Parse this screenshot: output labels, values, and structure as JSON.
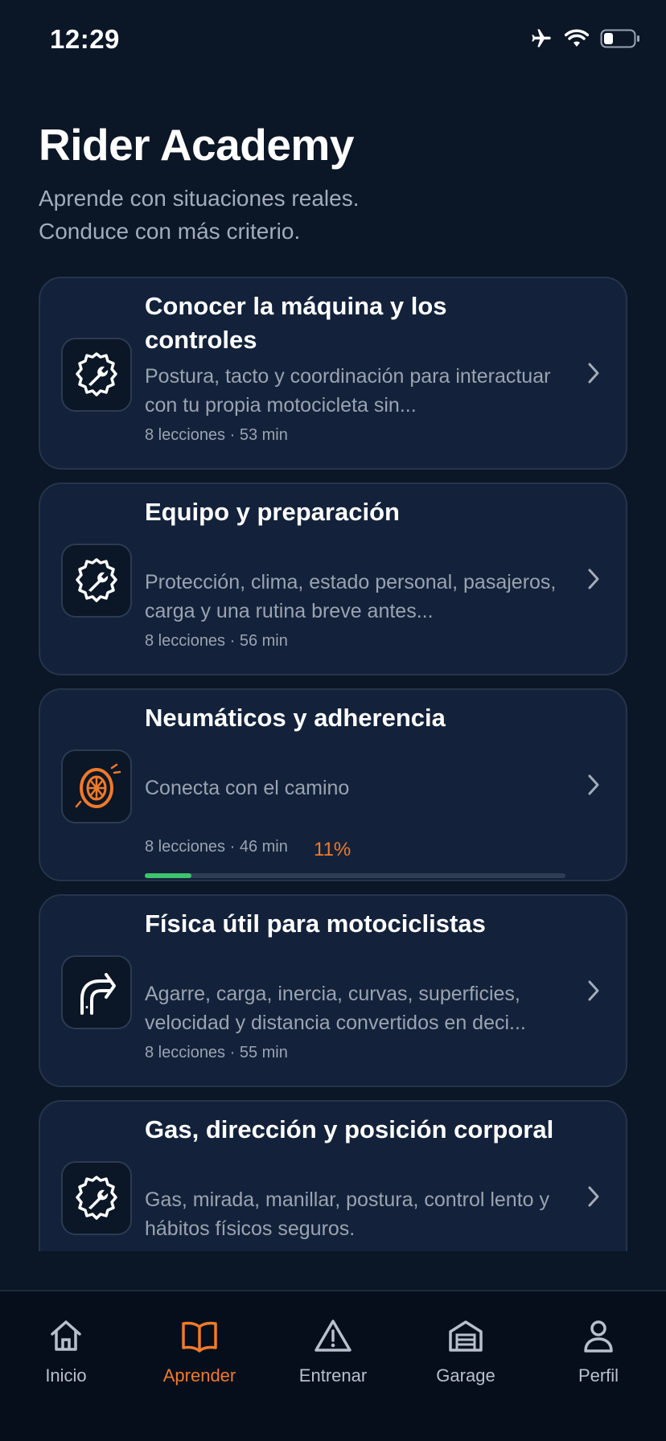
{
  "status_bar": {
    "time": "12:29"
  },
  "header": {
    "title": "Rider Academy",
    "subtitle_line1": "Aprende con situaciones reales.",
    "subtitle_line2": "Conduce con más criterio."
  },
  "courses": [
    {
      "icon": "gear-wrench-icon",
      "title": "Conocer la máquina y los controles",
      "description": "Postura, tacto y coordinación para interactuar con tu propia motocicleta sin...",
      "meta": "8 lecciones · 53 min"
    },
    {
      "icon": "gear-wrench-icon",
      "title": "Equipo y preparación",
      "description": "Protección, clima, estado personal, pasajeros, carga y una rutina breve antes...",
      "meta": "8 lecciones · 56 min"
    },
    {
      "icon": "tire-icon",
      "title": "Neumáticos y adherencia",
      "description": "Conecta con el camino",
      "meta": "8 lecciones · 46 min",
      "progress_label": "11%",
      "progress": 0.11
    },
    {
      "icon": "curve-arrow-icon",
      "title": "Física útil para motociclistas",
      "description": "Agarre, carga, inercia, curvas, superficies, velocidad y distancia convertidos en deci...",
      "meta": "8 lecciones · 55 min"
    },
    {
      "icon": "gear-wrench-icon",
      "title": "Gas, dirección y posición corporal",
      "description": "Gas, mirada, manillar, postura, control lento y hábitos físicos seguros.",
      "meta": ""
    }
  ],
  "tab_bar": {
    "active": "Aprender",
    "tabs": [
      {
        "label": "Inicio",
        "icon": "home-icon"
      },
      {
        "label": "Aprender",
        "icon": "book-icon"
      },
      {
        "label": "Entrenar",
        "icon": "warning-icon"
      },
      {
        "label": "Garage",
        "icon": "garage-icon"
      },
      {
        "label": "Perfil",
        "icon": "person-icon"
      }
    ]
  },
  "colors": {
    "background": "#0b1626",
    "card": "#13223a",
    "accent": "#f07a2a",
    "progress": "#3ec46d",
    "muted_text": "#9aa3b1"
  }
}
